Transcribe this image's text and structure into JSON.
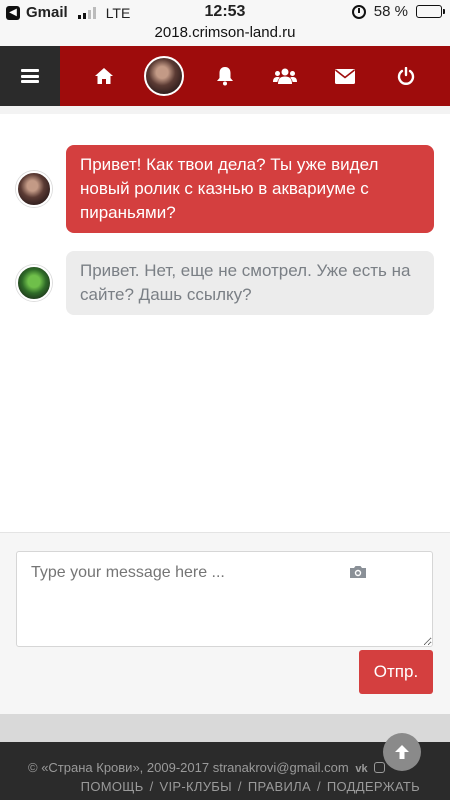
{
  "status_bar": {
    "back_app": "Gmail",
    "network": "LTE",
    "time": "12:53",
    "battery_percent": "58 %",
    "battery_level": 0.58
  },
  "url": "2018.crimson-land.ru",
  "nav": {
    "icons": [
      "menu-icon",
      "home-icon",
      "avatar",
      "bell-icon",
      "users-icon",
      "envelope-icon",
      "power-icon"
    ]
  },
  "messages": [
    {
      "from": "me",
      "text": "Привет! Как твои дела? Ты уже видел новый ролик с казнью в аквариуме с пираньями?"
    },
    {
      "from": "other",
      "text": "Привет. Нет, еще не смотрел. Уже есть на сайте? Дашь ссылку?"
    }
  ],
  "composer": {
    "placeholder": "Type your message here ...",
    "send_label": "Отпр."
  },
  "footer": {
    "copyright": "© «Страна Крови», 2009-2017",
    "email": "stranakrovi@gmail.com",
    "links": [
      "ПОМОЩЬ",
      "VIP-КЛУБЫ",
      "ПРАВИЛА",
      "ПОДДЕРЖАТЬ"
    ]
  },
  "colors": {
    "nav": "#9e0c0c",
    "accent": "#d43f3f",
    "footer": "#2b2b2b"
  }
}
